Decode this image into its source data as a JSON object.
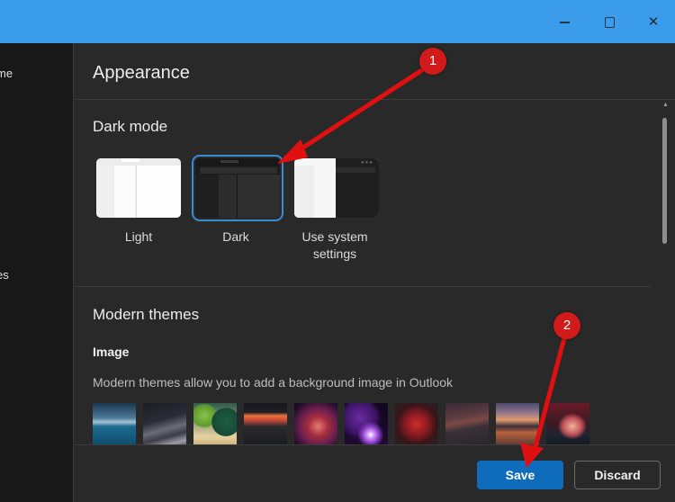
{
  "window": {
    "controls": {
      "minimize": "minimize",
      "maximize": "maximize",
      "close": "✕"
    }
  },
  "sidebar": {
    "items": [
      {
        "label": "me"
      },
      {
        "label": "es"
      }
    ]
  },
  "panel": {
    "title": "Appearance",
    "dark_mode": {
      "title": "Dark mode",
      "options": [
        {
          "label": "Light",
          "selected": false
        },
        {
          "label": "Dark",
          "selected": true
        },
        {
          "label": "Use system settings",
          "selected": false
        }
      ]
    },
    "modern_themes": {
      "title": "Modern themes",
      "subtitle": "Image",
      "description": "Modern themes allow you to add a background image in Outlook",
      "themes": [
        {
          "name": "mountain-lake"
        },
        {
          "name": "dark-waves"
        },
        {
          "name": "green-abstract"
        },
        {
          "name": "lava-landscape"
        },
        {
          "name": "swirl-abstract"
        },
        {
          "name": "purple-spheres"
        },
        {
          "name": "red-flowers"
        },
        {
          "name": "desert-dunes"
        },
        {
          "name": "sunset-lake"
        },
        {
          "name": "tent-night"
        }
      ]
    }
  },
  "footer": {
    "save_label": "Save",
    "discard_label": "Discard"
  },
  "annotations": [
    {
      "number": "1"
    },
    {
      "number": "2"
    }
  ],
  "colors": {
    "titlebar": "#3a9ceb",
    "accent": "#0f6cbd",
    "selection_outline": "#3a8ad4",
    "annotation": "#d11a1a"
  }
}
